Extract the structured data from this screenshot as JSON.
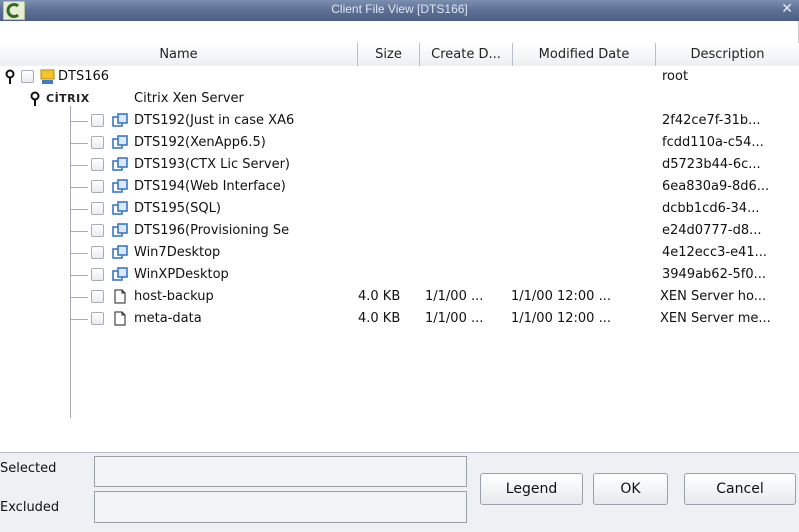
{
  "window": {
    "title": "Client File View [DTS166]",
    "close": "✕"
  },
  "columns": [
    "Name",
    "Size",
    "Create D...",
    "Modified Date",
    "Description"
  ],
  "tree": {
    "root": {
      "name": "DTS166",
      "description": "root"
    },
    "group": {
      "logo": "CİTRIX",
      "name": "Citrix Xen Server"
    },
    "items": [
      {
        "name": "DTS192(Just in case XA6",
        "size": "",
        "created": "",
        "modified": "",
        "description": "2f42ce7f-31b...",
        "icon": "vm-icon"
      },
      {
        "name": "DTS192(XenApp6.5)",
        "size": "",
        "created": "",
        "modified": "",
        "description": "fcdd110a-c54...",
        "icon": "vm-icon"
      },
      {
        "name": "DTS193(CTX Lic Server)",
        "size": "",
        "created": "",
        "modified": "",
        "description": "d5723b44-6c...",
        "icon": "vm-icon"
      },
      {
        "name": "DTS194(Web Interface)",
        "size": "",
        "created": "",
        "modified": "",
        "description": "6ea830a9-8d6...",
        "icon": "vm-icon"
      },
      {
        "name": "DTS195(SQL)",
        "size": "",
        "created": "",
        "modified": "",
        "description": "dcbb1cd6-34...",
        "icon": "vm-icon"
      },
      {
        "name": "DTS196(Provisioning Se",
        "size": "",
        "created": "",
        "modified": "",
        "description": "e24d0777-d8...",
        "icon": "vm-icon"
      },
      {
        "name": "Win7Desktop",
        "size": "",
        "created": "",
        "modified": "",
        "description": "4e12ecc3-e41...",
        "icon": "vm-icon"
      },
      {
        "name": "WinXPDesktop",
        "size": "",
        "created": "",
        "modified": "",
        "description": "3949ab62-5f0...",
        "icon": "vm-icon"
      },
      {
        "name": "host-backup",
        "size": "4.0 KB",
        "created": "1/1/00 ...",
        "modified": "1/1/00 12:00 ...",
        "description": "XEN Server ho...",
        "icon": "file-icon"
      },
      {
        "name": "meta-data",
        "size": "4.0 KB",
        "created": "1/1/00 ...",
        "modified": "1/1/00 12:00 ...",
        "description": "XEN Server me...",
        "icon": "file-icon"
      }
    ]
  },
  "footer": {
    "selected_label": "Selected",
    "selected_value": "",
    "excluded_label": "Excluded",
    "excluded_value": "",
    "legend": "Legend",
    "ok": "OK",
    "cancel": "Cancel"
  }
}
